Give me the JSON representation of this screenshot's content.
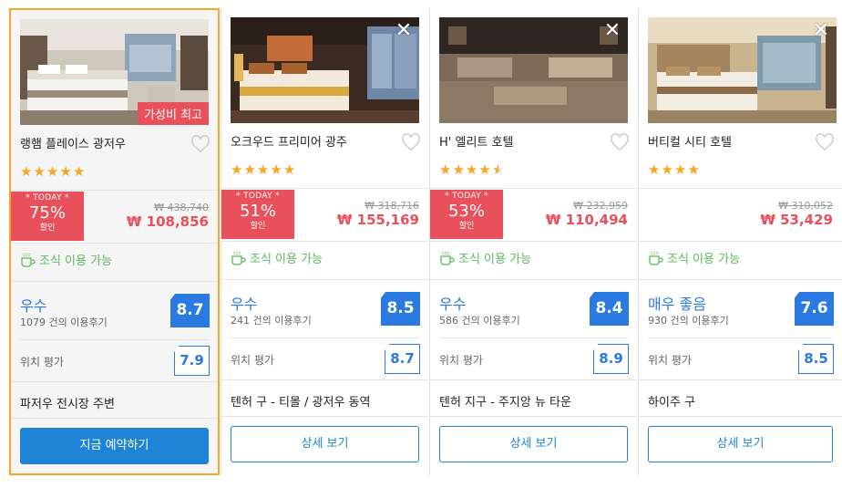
{
  "hotels": [
    {
      "name": "랭햄 플레이스 광저우",
      "badge": "가성비 최고",
      "stars": 5,
      "deal_today": "* TODAY *",
      "discount": "75%",
      "discount_suffix": "할인",
      "original_price": "₩ 438,740",
      "price": "₩ 108,856",
      "breakfast": "조식 이용 가능",
      "rating_label": "우수",
      "reviews": "1079 건의 이용후기",
      "score": "8.7",
      "location_label": "위치 평가",
      "location_score": "7.9",
      "area": "파저우 전시장 주변",
      "button": "지금 예약하기"
    },
    {
      "name": "오크우드 프리미어 광주",
      "close": "✕",
      "stars": 5,
      "deal_today": "* TODAY *",
      "discount": "51%",
      "discount_suffix": "할인",
      "original_price": "₩ 318,716",
      "price": "₩ 155,169",
      "breakfast": "조식 이용 가능",
      "rating_label": "우수",
      "reviews": "241 건의 이용후기",
      "score": "8.5",
      "location_label": "위치 평가",
      "location_score": "8.7",
      "area": "텐허 구 - 티몰 / 광저우 동역",
      "button": "상세 보기"
    },
    {
      "name": "H' 엘리트 호텔",
      "close": "✕",
      "stars": 4.5,
      "deal_today": "* TODAY *",
      "discount": "53%",
      "discount_suffix": "할인",
      "original_price": "₩ 232,959",
      "price": "₩ 110,494",
      "breakfast": "조식 이용 가능",
      "rating_label": "우수",
      "reviews": "586 건의 이용후기",
      "score": "8.4",
      "location_label": "위치 평가",
      "location_score": "8.9",
      "area": "텐허 지구 - 주지앙 뉴 타운",
      "button": "상세 보기"
    },
    {
      "name": "버티컬 시티 호텔",
      "close": "✕",
      "stars": 4,
      "original_price": "₩ 310,052",
      "price": "₩ 53,429",
      "breakfast": "조식 이용 가능",
      "rating_label": "매우 좋음",
      "reviews": "930 건의 이용후기",
      "score": "7.6",
      "location_label": "위치 평가",
      "location_score": "8.5",
      "area": "하이주 구",
      "button": "상세 보기"
    }
  ],
  "icons": {
    "close": "close-icon",
    "heart": "heart-icon",
    "breakfast": "coffee-cup-icon",
    "star": "star-icon"
  },
  "colors": {
    "accent_blue": "#1f84d6",
    "deal_red": "#e8505b",
    "star_orange": "#f5a623",
    "breakfast_green": "#5cb85c",
    "highlight_border": "#f5a623"
  }
}
